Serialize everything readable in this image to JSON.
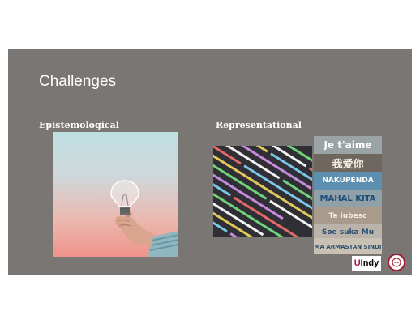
{
  "slide": {
    "title": "Challenges",
    "left_heading": "Epistemological",
    "right_heading": "Representational",
    "language_planks": [
      "Je t'aime",
      "我爱你",
      "NAKUPENDA",
      "MAHAL KITA",
      "Te iubesc",
      "Soe suka Mu",
      "MA ARMASTAN SINDI"
    ],
    "logos": {
      "uindy_first": "U",
      "uindy_rest": "Indy"
    }
  },
  "colors": {
    "slide_background": "#7a7674",
    "uindy_red": "#a4123f"
  }
}
